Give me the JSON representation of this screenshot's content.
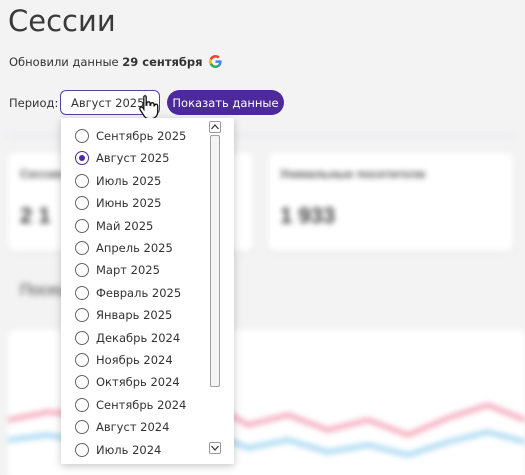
{
  "page": {
    "title": "Сессии",
    "updated_prefix": "Обновили данные",
    "updated_date": "29 сентября"
  },
  "filter": {
    "period_label": "Период:",
    "selected_period": "Август 2025",
    "show_button": "Показать данные"
  },
  "dropdown": {
    "options": [
      {
        "label": "Сентябрь 2025",
        "checked": false
      },
      {
        "label": "Август 2025",
        "checked": true
      },
      {
        "label": "Июль 2025",
        "checked": false
      },
      {
        "label": "Июнь 2025",
        "checked": false
      },
      {
        "label": "Май 2025",
        "checked": false
      },
      {
        "label": "Апрель 2025",
        "checked": false
      },
      {
        "label": "Март 2025",
        "checked": false
      },
      {
        "label": "Февраль 2025",
        "checked": false
      },
      {
        "label": "Январь 2025",
        "checked": false
      },
      {
        "label": "Декабрь 2024",
        "checked": false
      },
      {
        "label": "Ноябрь 2024",
        "checked": false
      },
      {
        "label": "Октябрь 2024",
        "checked": false
      },
      {
        "label": "Сентябрь 2024",
        "checked": false
      },
      {
        "label": "Август 2024",
        "checked": false
      },
      {
        "label": "Июль 2024",
        "checked": false
      }
    ]
  },
  "background": {
    "card1_label": "Сессии",
    "card1_value": "2 1",
    "card2_label": "Уникальные посетители",
    "card2_value": "1 933",
    "section_title": "Посещ"
  },
  "colors": {
    "accent": "#4d2a9c",
    "line_pink": "#f4a9bd",
    "line_blue": "#a9d9f2"
  }
}
